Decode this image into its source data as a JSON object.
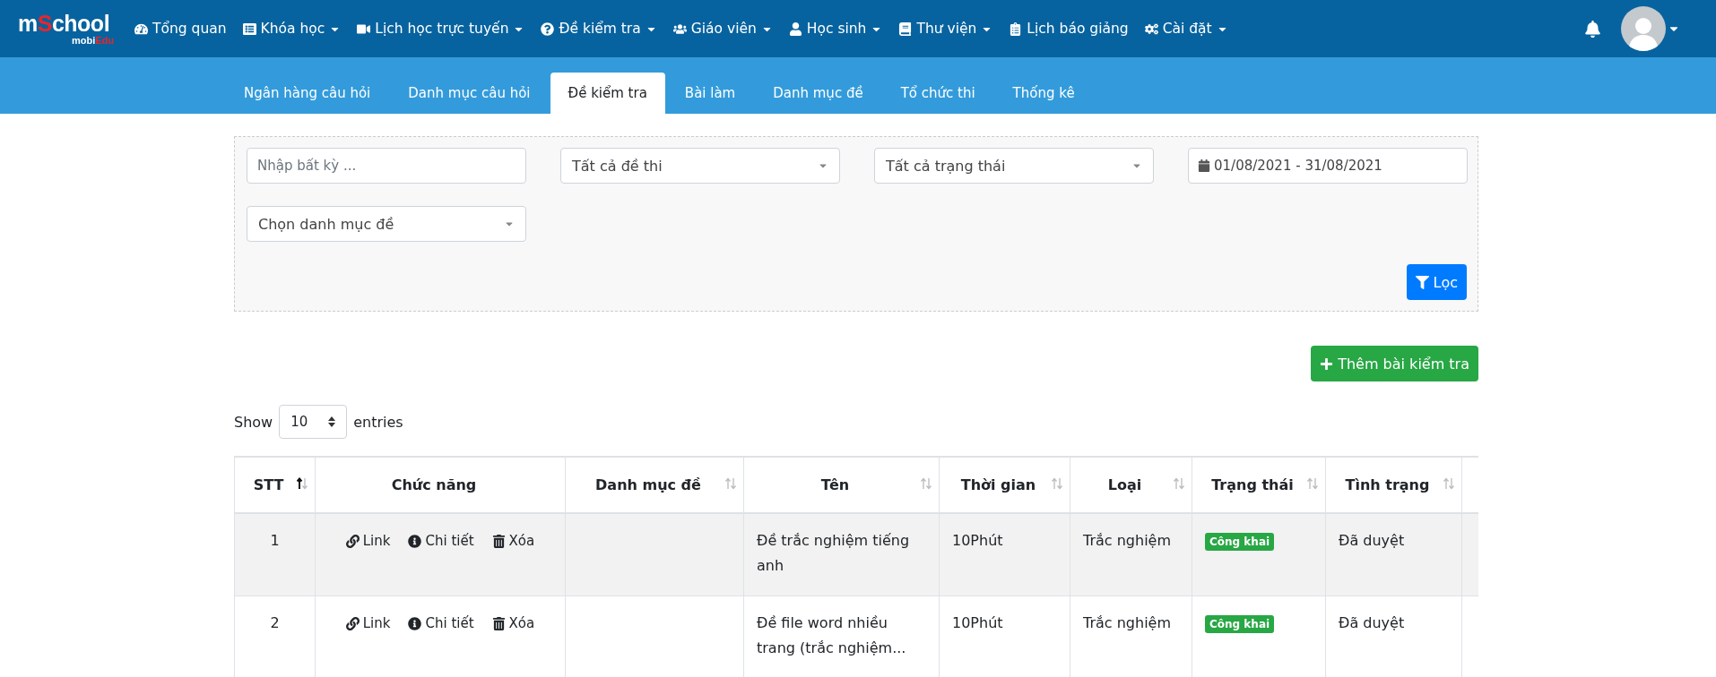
{
  "logo": {
    "prefix": "m",
    "highlight": "S",
    "rest": "chool",
    "sub": "mobi",
    "sub_highlight": "Edu"
  },
  "nav": [
    {
      "label": "Tổng quan",
      "dropdown": false
    },
    {
      "label": "Khóa học",
      "dropdown": true
    },
    {
      "label": "Lịch học trực tuyến",
      "dropdown": true
    },
    {
      "label": "Đề kiểm tra",
      "dropdown": true
    },
    {
      "label": "Giáo viên",
      "dropdown": true
    },
    {
      "label": "Học sinh",
      "dropdown": true
    },
    {
      "label": "Thư viện",
      "dropdown": true
    },
    {
      "label": "Lịch báo giảng",
      "dropdown": false
    },
    {
      "label": "Cài đặt",
      "dropdown": true
    }
  ],
  "tabs": [
    {
      "label": "Ngân hàng câu hỏi",
      "selected": false
    },
    {
      "label": "Danh mục câu hỏi",
      "selected": false
    },
    {
      "label": "Đề kiểm tra",
      "selected": true
    },
    {
      "label": "Bài làm",
      "selected": false
    },
    {
      "label": "Danh mục đề",
      "selected": false
    },
    {
      "label": "Tổ chức thi",
      "selected": false
    },
    {
      "label": "Thống kê",
      "selected": false
    }
  ],
  "filters": {
    "search": {
      "placeholder": "Nhập bất kỳ ..."
    },
    "exam_select": "Tất cả đề thi",
    "status_select": "Tất cả trạng thái",
    "date_range": "01/08/2021 - 31/08/2021",
    "category_select": "Chọn danh mục đề",
    "filter_button": "Lọc"
  },
  "add_button": "Thêm bài kiểm tra",
  "length": {
    "show": "Show",
    "value": "10",
    "entries": "entries"
  },
  "table": {
    "columns": [
      {
        "label": "STT",
        "sortable": true,
        "sorted": true
      },
      {
        "label": "Chức năng",
        "sortable": false,
        "sorted": false
      },
      {
        "label": "Danh mục đề",
        "sortable": true,
        "sorted": false
      },
      {
        "label": "Tên",
        "sortable": true,
        "sorted": false
      },
      {
        "label": "Thời gian",
        "sortable": true,
        "sorted": false
      },
      {
        "label": "Loại",
        "sortable": true,
        "sorted": false
      },
      {
        "label": "Trạng thái",
        "sortable": true,
        "sorted": false
      },
      {
        "label": "Tình trạng",
        "sortable": true,
        "sorted": false
      }
    ],
    "rows": [
      {
        "stt": "1",
        "actions": [
          "Link",
          "Chi tiết",
          "Xóa"
        ],
        "category": "",
        "name": "Đề trắc nghiệm tiếng anh",
        "time": "10Phút",
        "type": "Trắc nghiệm",
        "status": "Công khai",
        "condition": "Đã duyệt"
      },
      {
        "stt": "2",
        "actions": [
          "Link",
          "Chi tiết",
          "Xóa"
        ],
        "category": "",
        "name": "Đề file word nhiều trang (trắc nghiệm...",
        "time": "10Phút",
        "type": "Trắc nghiệm",
        "status": "Công khai",
        "condition": "Đã duyệt"
      }
    ]
  }
}
